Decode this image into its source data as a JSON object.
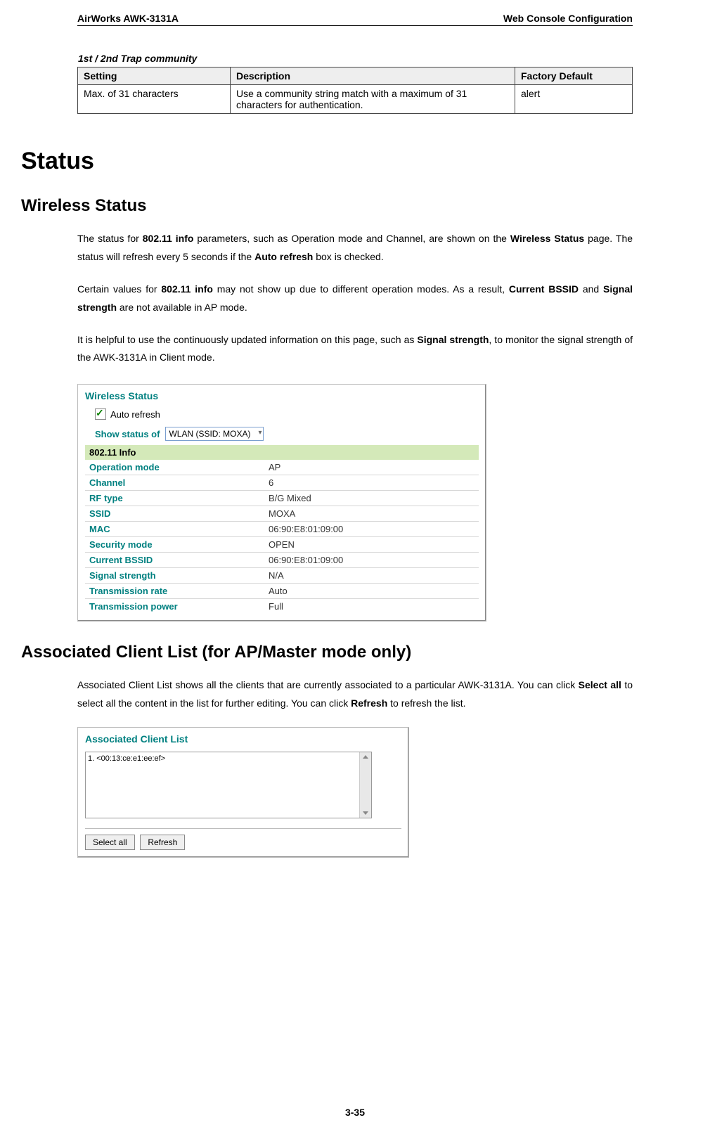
{
  "header": {
    "left": "AirWorks AWK-3131A",
    "right": "Web Console Configuration"
  },
  "trap_section_title": "1st / 2nd Trap community",
  "trap_table": {
    "headers": [
      "Setting",
      "Description",
      "Factory Default"
    ],
    "row": {
      "setting": "Max. of 31 characters",
      "description": "Use a community string match with a maximum of 31 characters for authentication.",
      "default": "alert"
    }
  },
  "status_h1": "Status",
  "wireless_h2": "Wireless Status",
  "wireless_paras": {
    "p1_pre": "The status for ",
    "p1_b1": "802.11 info",
    "p1_mid": " parameters, such as Operation mode and Channel, are shown on the ",
    "p1_b2": "Wireless Status",
    "p1_mid2": " page. The status will refresh every 5 seconds if the ",
    "p1_b3": "Auto refresh",
    "p1_end": " box is checked.",
    "p2_pre": "Certain values for ",
    "p2_b1": "802.11 info",
    "p2_mid": " may not show up due to different operation modes. As a result, ",
    "p2_b2": "Current BSSID",
    "p2_mid2": " and ",
    "p2_b3": "Signal strength",
    "p2_end": " are not available in AP mode.",
    "p3_pre": "It is helpful to use the continuously updated information on this page, such as ",
    "p3_b1": "Signal strength",
    "p3_end": ", to monitor the signal strength of the AWK-3131A in Client mode."
  },
  "wireless_screenshot": {
    "title": "Wireless Status",
    "auto_refresh_label": "Auto refresh",
    "show_status_label": "Show status of",
    "show_status_value": "WLAN (SSID: MOXA)",
    "info_header": "802.11 Info",
    "rows": [
      {
        "label": "Operation mode",
        "value": "AP"
      },
      {
        "label": "Channel",
        "value": "6"
      },
      {
        "label": "RF type",
        "value": "B/G Mixed"
      },
      {
        "label": "SSID",
        "value": "MOXA"
      },
      {
        "label": "MAC",
        "value": "06:90:E8:01:09:00"
      },
      {
        "label": "Security mode",
        "value": "OPEN"
      },
      {
        "label": "Current BSSID",
        "value": "06:90:E8:01:09:00"
      },
      {
        "label": "Signal strength",
        "value": "N/A"
      },
      {
        "label": "Transmission rate",
        "value": "Auto"
      },
      {
        "label": "Transmission power",
        "value": "Full"
      }
    ]
  },
  "acl_h2": "Associated Client List (for AP/Master mode only)",
  "acl_para": {
    "pre": "Associated Client List shows all the clients that are currently associated to a particular AWK-3131A. You can click ",
    "b1": "Select all",
    "mid": " to select all the content in the list for further editing. You can click ",
    "b2": "Refresh",
    "end": " to refresh the list."
  },
  "acl_screenshot": {
    "title": "Associated Client List",
    "list_item": "1.  <00:13:ce:e1:ee:ef>",
    "btn_select_all": "Select all",
    "btn_refresh": "Refresh"
  },
  "page_number": "3-35"
}
